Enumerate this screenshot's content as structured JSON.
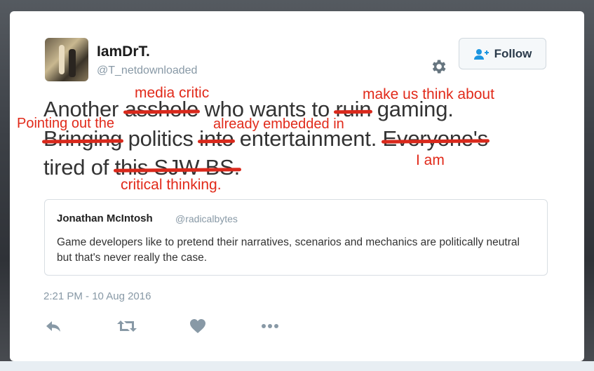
{
  "tweet": {
    "display_name": "IamDrT.",
    "handle": "@T_netdownloaded",
    "follow_label": "Follow",
    "line1": {
      "w1": "Another",
      "w2": "asshole",
      "w3": "who wants to",
      "w4": "ruin",
      "w5": "gaming."
    },
    "line2": {
      "w1": "Bringing",
      "w2": "politics",
      "w3": "into",
      "w4": "entertainment.",
      "w5": "Everyone's"
    },
    "line3": {
      "w1": "tired of",
      "w2": "this SJW BS."
    },
    "timestamp": "2:21 PM - 10 Aug 2016"
  },
  "annotations": {
    "media_critic": "media critic",
    "make_us_think": "make us think about",
    "pointing_out": "Pointing out the",
    "already_embedded": "already embedded in",
    "i_am": "I am",
    "critical_thinking": "critical thinking."
  },
  "quote": {
    "name": "Jonathan McIntosh",
    "handle": "@radicalbytes",
    "text": "Game developers like to pretend their narratives, scenarios and mechanics are politically neutral but that's never really the case."
  },
  "icons": [
    "gear-icon",
    "follow-person-icon",
    "reply-icon",
    "retweet-icon",
    "like-icon",
    "more-icon"
  ],
  "colors": {
    "annotation": "#e12a1a",
    "strike": "#d9291c",
    "muted": "#8899a6"
  }
}
